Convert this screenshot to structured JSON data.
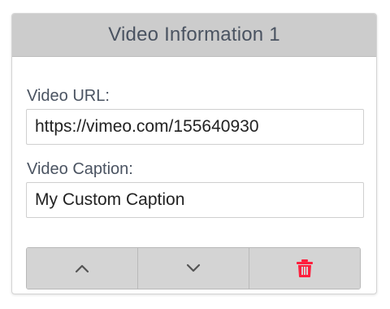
{
  "panel": {
    "title": "Video Information 1"
  },
  "fields": {
    "url": {
      "label": "Video URL:",
      "value": "https://vimeo.com/155640930"
    },
    "caption": {
      "label": "Video Caption:",
      "value": "My Custom Caption"
    }
  },
  "actions": {
    "move_up_icon": "chevron-up-icon",
    "move_down_icon": "chevron-down-icon",
    "delete_icon": "trash-icon",
    "delete_color": "#ff1f3d",
    "icon_color": "#555555"
  },
  "colors": {
    "header_bg": "#cccccc",
    "button_bg": "#d4d4d4",
    "text": "#4a5361"
  }
}
